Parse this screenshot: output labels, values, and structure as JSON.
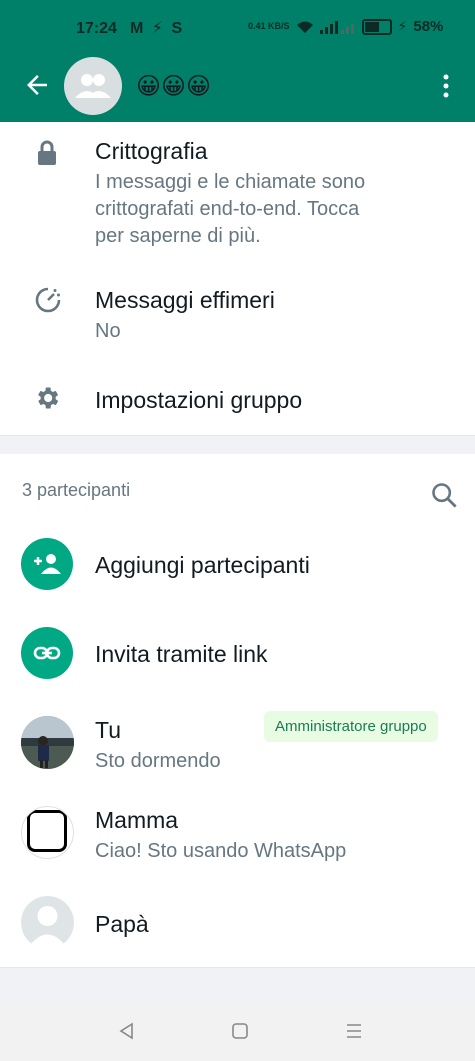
{
  "status_bar": {
    "time": "17:24",
    "icons": "M ⚡ S",
    "speed": "0.41 KB/S",
    "battery": "58%"
  },
  "header": {
    "title": "😀😀😀",
    "icon_names": [
      "back-arrow-icon",
      "group-avatar-icon",
      "more-vert-icon"
    ]
  },
  "settings": {
    "encryption": {
      "title": "Crittografia",
      "desc_lines": [
        "I messaggi e le chiamate sono",
        "crittografati end-to-end. Tocca",
        "per saperne di più."
      ]
    },
    "ephemeral": {
      "title": "Messaggi effimeri",
      "value": "No"
    },
    "group_settings": {
      "title": "Impostazioni gruppo"
    }
  },
  "participants": {
    "count_label": "3 partecipanti",
    "add_label": "Aggiungi partecipanti",
    "invite_label": "Invita tramite link",
    "members": [
      {
        "name": "Tu",
        "status": "Sto dormendo",
        "badge": "Amministratore gruppo"
      },
      {
        "name": "Mamma",
        "status": "Ciao! Sto usando WhatsApp"
      },
      {
        "name": "Papà",
        "status": ""
      }
    ]
  },
  "colors": {
    "header": "#008069",
    "accent": "#00a884",
    "badge_bg": "#e7fce3"
  }
}
